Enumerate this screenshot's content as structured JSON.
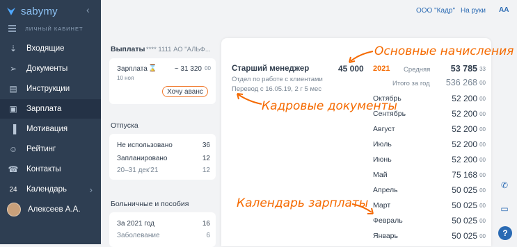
{
  "app": {
    "logo_text": "sabymy",
    "cabinet_label": "ЛИЧНЫЙ КАБИНЕТ"
  },
  "sidebar": {
    "items": [
      {
        "label": "Входящие",
        "icon": "inbox-icon"
      },
      {
        "label": "Документы",
        "icon": "send-icon"
      },
      {
        "label": "Инструкции",
        "icon": "book-icon"
      },
      {
        "label": "Зарплата",
        "icon": "wallet-icon",
        "active": true
      },
      {
        "label": "Мотивация",
        "icon": "bar-chart-icon"
      },
      {
        "label": "Рейтинг",
        "icon": "people-icon"
      },
      {
        "label": "Контакты",
        "icon": "phone-icon"
      },
      {
        "label": "Календарь",
        "icon": "calendar-icon",
        "badge": "24"
      },
      {
        "label": "Алексеев А.А.",
        "icon": "avatar"
      }
    ]
  },
  "header": {
    "company": "ООО \"Кадр\"",
    "on_hand": "На руки",
    "font_size_label": "AA"
  },
  "payouts": {
    "title": "Выплаты",
    "account": "**** 1111  АО \"АЛЬФ...",
    "salary_label": "Зарплата",
    "salary_amount": "~ 31 320",
    "salary_amount_suffix": "00",
    "salary_date": "10 ноя",
    "advance_button": "Хочу аванс"
  },
  "vacation": {
    "title": "Отпуска",
    "rows": [
      {
        "label": "Не использовано",
        "value": "36"
      },
      {
        "label": "Запланировано",
        "value": "12"
      },
      {
        "label": "20–31 дек'21",
        "value": "12"
      }
    ]
  },
  "sick": {
    "title": "Больничные и пособия",
    "rows": [
      {
        "label": "За 2021 год",
        "value": "16"
      },
      {
        "label": "Заболевание",
        "value": "6"
      }
    ]
  },
  "position": {
    "title": "Старший менеджер",
    "salary": "45 000",
    "department": "Отдел по работе с клиентами",
    "transfer": "Перевод с 16.05.19, 2 г 5 мес"
  },
  "summary": {
    "year": "2021",
    "avg_label": "Средняя",
    "avg_value": "53 785",
    "avg_value_suffix": "33",
    "total_label": "Итого за год",
    "total_value": "536 268",
    "total_value_suffix": "00"
  },
  "months": [
    {
      "label": "Октябрь",
      "value": "52 200",
      "suffix": "00"
    },
    {
      "label": "Сентябрь",
      "value": "52 200",
      "suffix": "00"
    },
    {
      "label": "Август",
      "value": "52 200",
      "suffix": "00"
    },
    {
      "label": "Июль",
      "value": "52 200",
      "suffix": "00"
    },
    {
      "label": "Июнь",
      "value": "52 200",
      "suffix": "00"
    },
    {
      "label": "Май",
      "value": "75 168",
      "suffix": "00"
    },
    {
      "label": "Апрель",
      "value": "50 025",
      "suffix": "00"
    },
    {
      "label": "Март",
      "value": "50 025",
      "suffix": "00"
    },
    {
      "label": "Февраль",
      "value": "50 025",
      "suffix": "00"
    },
    {
      "label": "Январь",
      "value": "50 025",
      "suffix": "00"
    }
  ],
  "annotations": {
    "main_accruals": "Основные начисления",
    "hr_documents": "Кадровые документы",
    "salary_calendar": "Календарь зарплаты"
  },
  "colors": {
    "sidebar": "#2e3e52",
    "accent": "#f56a00",
    "link": "#2a6ab3",
    "year": "#f56a00"
  }
}
